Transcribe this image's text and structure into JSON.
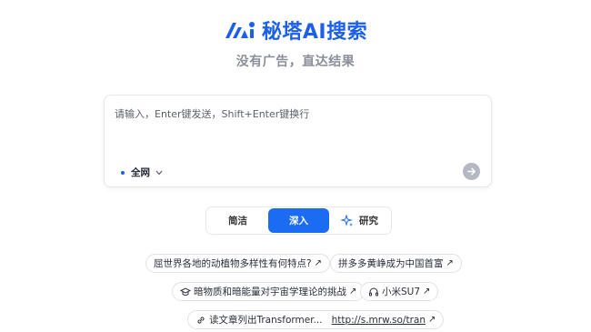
{
  "brand": {
    "name": "秘塔AI搜索",
    "tagline": "没有广告，直达结果",
    "logo_color": "#1b5fea"
  },
  "search": {
    "placeholder": "请输入，Enter键发送，Shift+Enter键换行",
    "scope_label": "全网",
    "send_icon": "arrow-right-icon"
  },
  "modes": [
    {
      "label": "简洁",
      "active": false
    },
    {
      "label": "深入",
      "active": true
    },
    {
      "label": "研究",
      "active": false,
      "icon": "sparkle-icon"
    }
  ],
  "suggestions": [
    {
      "text": "屈世界各地的动植物多样性有何特点?",
      "arrow": "↗"
    },
    {
      "text": "拼多多黄峥成为中国首富",
      "arrow": "↗"
    },
    {
      "text": "暗物质和暗能量对宇宙学理论的挑战",
      "arrow": "↗",
      "icon": "graduation-cap-icon"
    },
    {
      "text": "小米SU7",
      "arrow": "↗",
      "icon": "headphones-icon"
    },
    {
      "text": "读文章列出Transformer...",
      "url": "http://s.mrw.so/tran",
      "arrow": "↗",
      "icon": "link-icon"
    }
  ],
  "colors": {
    "accent": "#1b6cf2",
    "send_button": "#b3b8c2"
  }
}
